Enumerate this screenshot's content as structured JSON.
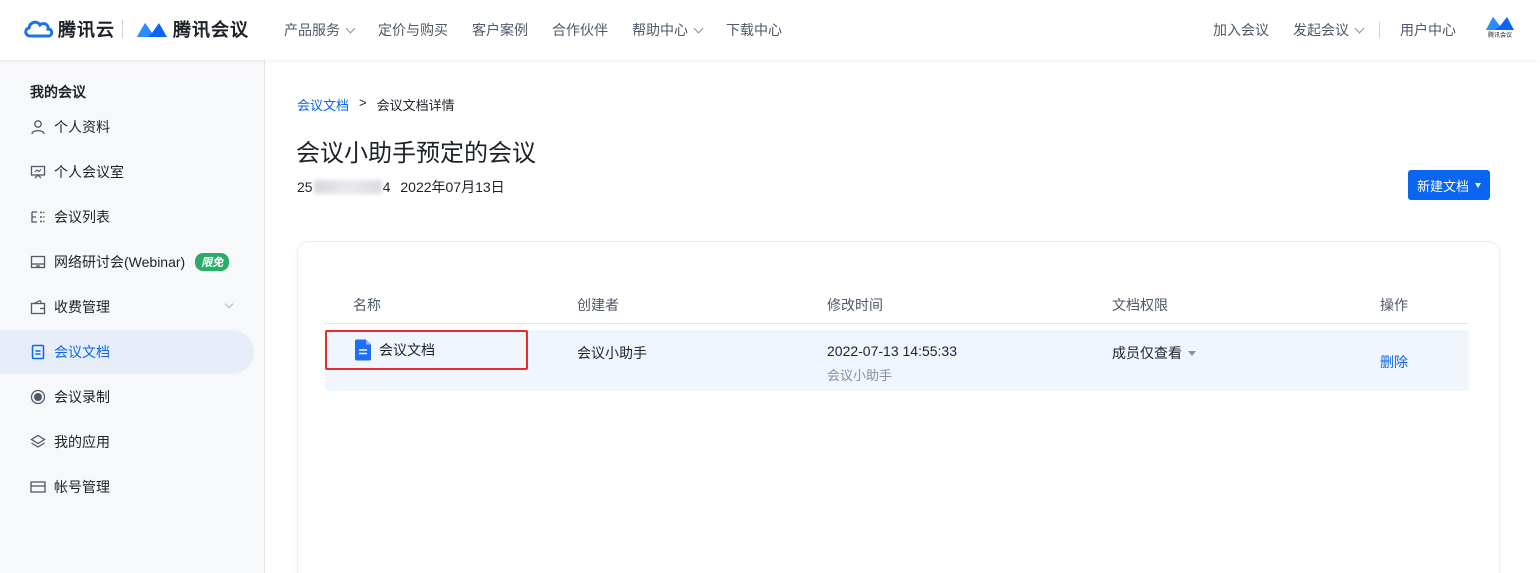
{
  "header": {
    "brand_cloud": "腾讯云",
    "brand_meeting": "腾讯会议",
    "nav": [
      {
        "label": "产品服务",
        "has_dropdown": true
      },
      {
        "label": "定价与购买",
        "has_dropdown": false
      },
      {
        "label": "客户案例",
        "has_dropdown": false
      },
      {
        "label": "合作伙伴",
        "has_dropdown": false
      },
      {
        "label": "帮助中心",
        "has_dropdown": true
      },
      {
        "label": "下载中心",
        "has_dropdown": false
      }
    ],
    "join_meeting": "加入会议",
    "start_meeting": "发起会议",
    "user_center": "用户中心",
    "avatar_label": "腾讯会议"
  },
  "sidebar": {
    "title": "我的会议",
    "items": [
      {
        "label": "个人资料",
        "icon": "user-icon"
      },
      {
        "label": "个人会议室",
        "icon": "meeting-room-icon"
      },
      {
        "label": "会议列表",
        "icon": "list-icon"
      },
      {
        "label": "网络研讨会(Webinar)",
        "icon": "webinar-icon",
        "badge": "限免"
      },
      {
        "label": "收费管理",
        "icon": "wallet-icon",
        "has_dropdown": true
      },
      {
        "label": "会议文档",
        "icon": "document-icon",
        "active": true
      },
      {
        "label": "会议录制",
        "icon": "record-icon"
      },
      {
        "label": "我的应用",
        "icon": "layers-icon"
      },
      {
        "label": "帐号管理",
        "icon": "card-icon"
      }
    ]
  },
  "breadcrumb": {
    "parent": "会议文档",
    "separator": ">",
    "current": "会议文档详情"
  },
  "page": {
    "title": "会议小助手预定的会议",
    "meeting_id_prefix": "25",
    "meeting_id_suffix": "4",
    "date": "2022年07月13日",
    "new_doc_button": "新建文档"
  },
  "table": {
    "headers": [
      "名称",
      "创建者",
      "修改时间",
      "文档权限",
      "操作"
    ],
    "rows": [
      {
        "name": "会议文档",
        "creator": "会议小助手",
        "modified_time": "2022-07-13 14:55:33",
        "modified_by": "会议小助手",
        "permission": "成员仅查看",
        "action": "删除"
      }
    ]
  },
  "colors": {
    "accent": "#0a65f0",
    "active_bg": "#e8eef9",
    "highlight_border": "#e02e2a",
    "badge_green": "#2aae67"
  }
}
